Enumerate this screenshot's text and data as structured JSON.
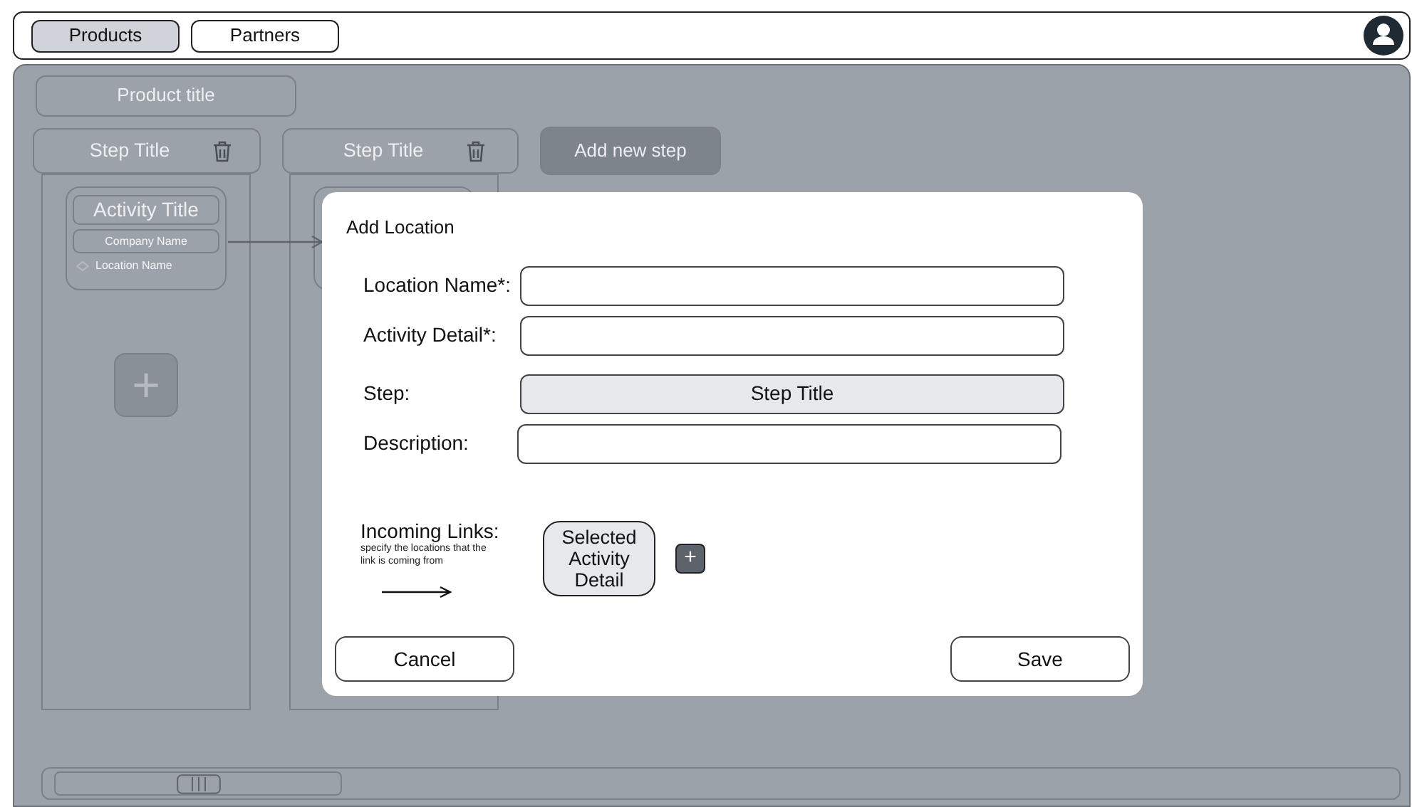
{
  "nav_tabs": [
    {
      "label": "Products",
      "selected": true
    },
    {
      "label": "Partners",
      "selected": false
    }
  ],
  "product_title": "Product title",
  "steps": [
    {
      "title": "Step Title",
      "activities": [
        {
          "kind": "card",
          "title": "Activity Title",
          "company": "Company Name",
          "location": "Location Name"
        }
      ],
      "add_label": "+"
    },
    {
      "title": "Step Title",
      "activities": [
        {
          "kind": "covered"
        }
      ]
    }
  ],
  "add_step_button": "Add new step",
  "dialog": {
    "title": "Add Location",
    "fields": [
      {
        "kind": "input",
        "label": "Location Name*:"
      },
      {
        "kind": "input",
        "label": "Activity Detail*:"
      },
      {
        "kind": "select",
        "label": "Step:",
        "value": "Step Title"
      },
      {
        "kind": "input",
        "label": "Description:"
      }
    ],
    "incoming_links": {
      "label": "Incoming Links:",
      "hint": "specify the locations that the link is coming from",
      "selected": [
        "Selected Activity Detail"
      ],
      "add_label": "+"
    },
    "buttons": [
      "Cancel",
      "Save"
    ]
  }
}
